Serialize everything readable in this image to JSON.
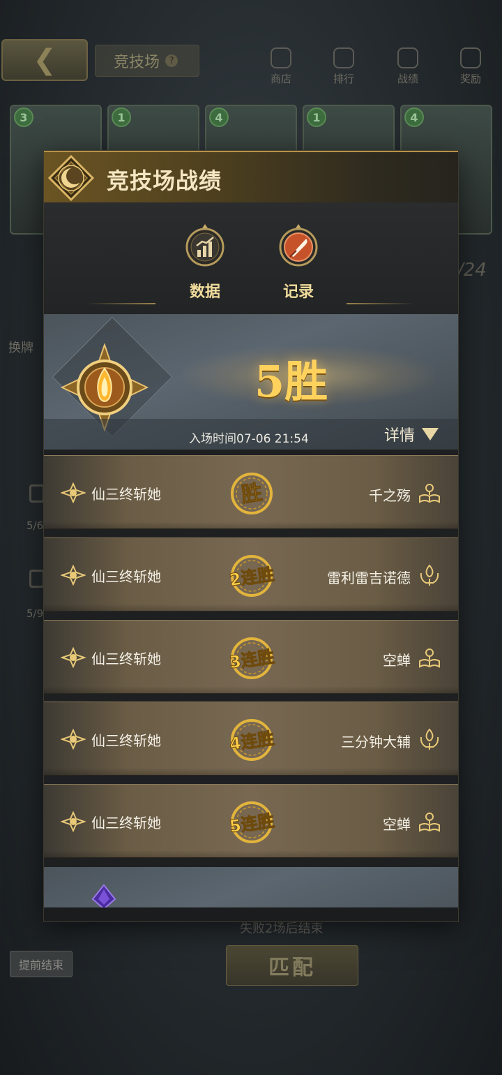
{
  "background": {
    "title": "竞技场",
    "nav": [
      "商店",
      "排行",
      "战绩",
      "奖励"
    ],
    "card_costs": [
      "3",
      "1",
      "4",
      "1",
      "4"
    ],
    "side_label": "换牌",
    "lock_counts": [
      "5/6",
      "5/9"
    ],
    "count_display": "/24",
    "loss_note": "失败2场后结束",
    "match_button": "匹配",
    "end_button": "提前结束"
  },
  "modal": {
    "title": "竞技场战绩",
    "tabs": [
      {
        "label": "数据",
        "icon": "chart-icon",
        "active": false
      },
      {
        "label": "记录",
        "icon": "quill-icon",
        "active": true
      }
    ],
    "summary": {
      "wins_text": "5胜",
      "entry_time": "入场时间07-06 21:54",
      "detail_label": "详情"
    },
    "matches": [
      {
        "player": "仙三终斩她",
        "result": "胜",
        "opponent": "千之殇",
        "opponent_icon": "book-hand-icon"
      },
      {
        "player": "仙三终斩她",
        "result": "2连胜",
        "opponent": "雷利雷吉诺德",
        "opponent_icon": "flame-hand-icon"
      },
      {
        "player": "仙三终斩她",
        "result": "3连胜",
        "opponent": "空蝉",
        "opponent_icon": "book-hand-icon"
      },
      {
        "player": "仙三终斩她",
        "result": "4连胜",
        "opponent": "三分钟大辅",
        "opponent_icon": "flame-hand-icon"
      },
      {
        "player": "仙三终斩她",
        "result": "5连胜",
        "opponent": "空蝉",
        "opponent_icon": "book-hand-icon"
      }
    ]
  },
  "colors": {
    "gold": "#ffd25e",
    "header_gold": "#6b5423",
    "row_brown": "#786852"
  }
}
